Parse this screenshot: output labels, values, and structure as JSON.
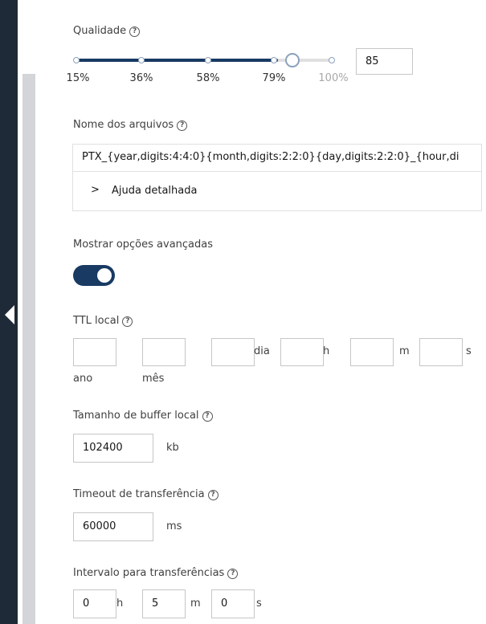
{
  "quality": {
    "label": "Qualidade",
    "value": "85",
    "slider_fraction": 0.79,
    "ticks": [
      "15%",
      "36%",
      "58%",
      "79%",
      "100%"
    ]
  },
  "filename": {
    "label": "Nome dos arquivos",
    "value": "PTX_{year,digits:4:4:0}{month,digits:2:2:0}{day,digits:2:2:0}_{hour,di",
    "help_toggle": "Ajuda detalhada"
  },
  "advanced": {
    "label": "Mostrar opções avançadas",
    "enabled": true
  },
  "ttl": {
    "label": "TTL local",
    "units": {
      "day": "dia",
      "hour": "h",
      "minute": "m",
      "second": "s"
    },
    "below_labels": {
      "year": "ano",
      "month": "mês"
    }
  },
  "buffer": {
    "label": "Tamanho de buffer local",
    "value": "102400",
    "unit": "kb"
  },
  "timeout": {
    "label": "Timeout de transferência",
    "value": "60000",
    "unit": "ms"
  },
  "interval": {
    "label": "Intervalo para transferências",
    "hours": "0",
    "hours_unit": "h",
    "minutes": "5",
    "minutes_unit": "m",
    "seconds": "0",
    "seconds_unit": "s"
  },
  "colors": {
    "accent": "#183a63",
    "sidebar": "#1f2a38"
  }
}
